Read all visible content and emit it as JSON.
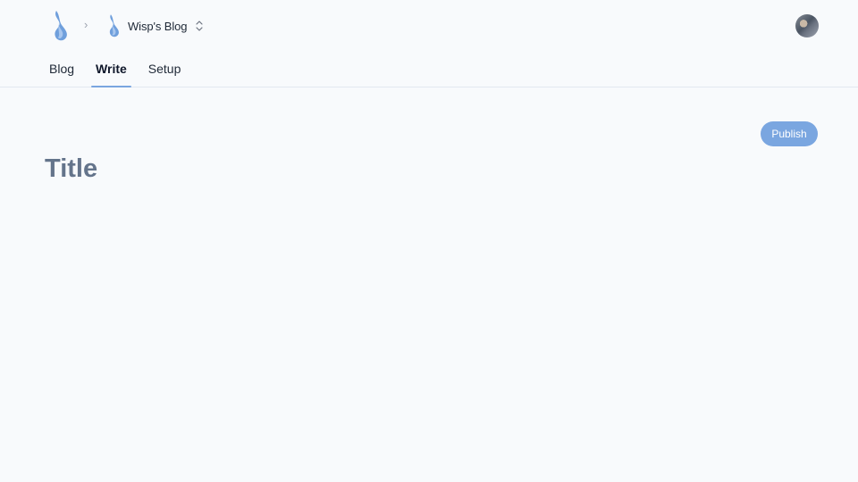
{
  "breadcrumb": {
    "separator": "›",
    "blog_name": "Wisp's Blog",
    "logo_icon": "flame-logo-icon",
    "switcher_icon": "chevron-up-down-icon"
  },
  "tabs": [
    {
      "label": "Blog",
      "active": false
    },
    {
      "label": "Write",
      "active": true
    },
    {
      "label": "Setup",
      "active": false
    }
  ],
  "editor": {
    "title_placeholder": "Title",
    "title_value": "",
    "publish_label": "Publish"
  },
  "colors": {
    "accent": "#7aa6e0",
    "background": "#f8fafc",
    "placeholder": "#64748b"
  }
}
